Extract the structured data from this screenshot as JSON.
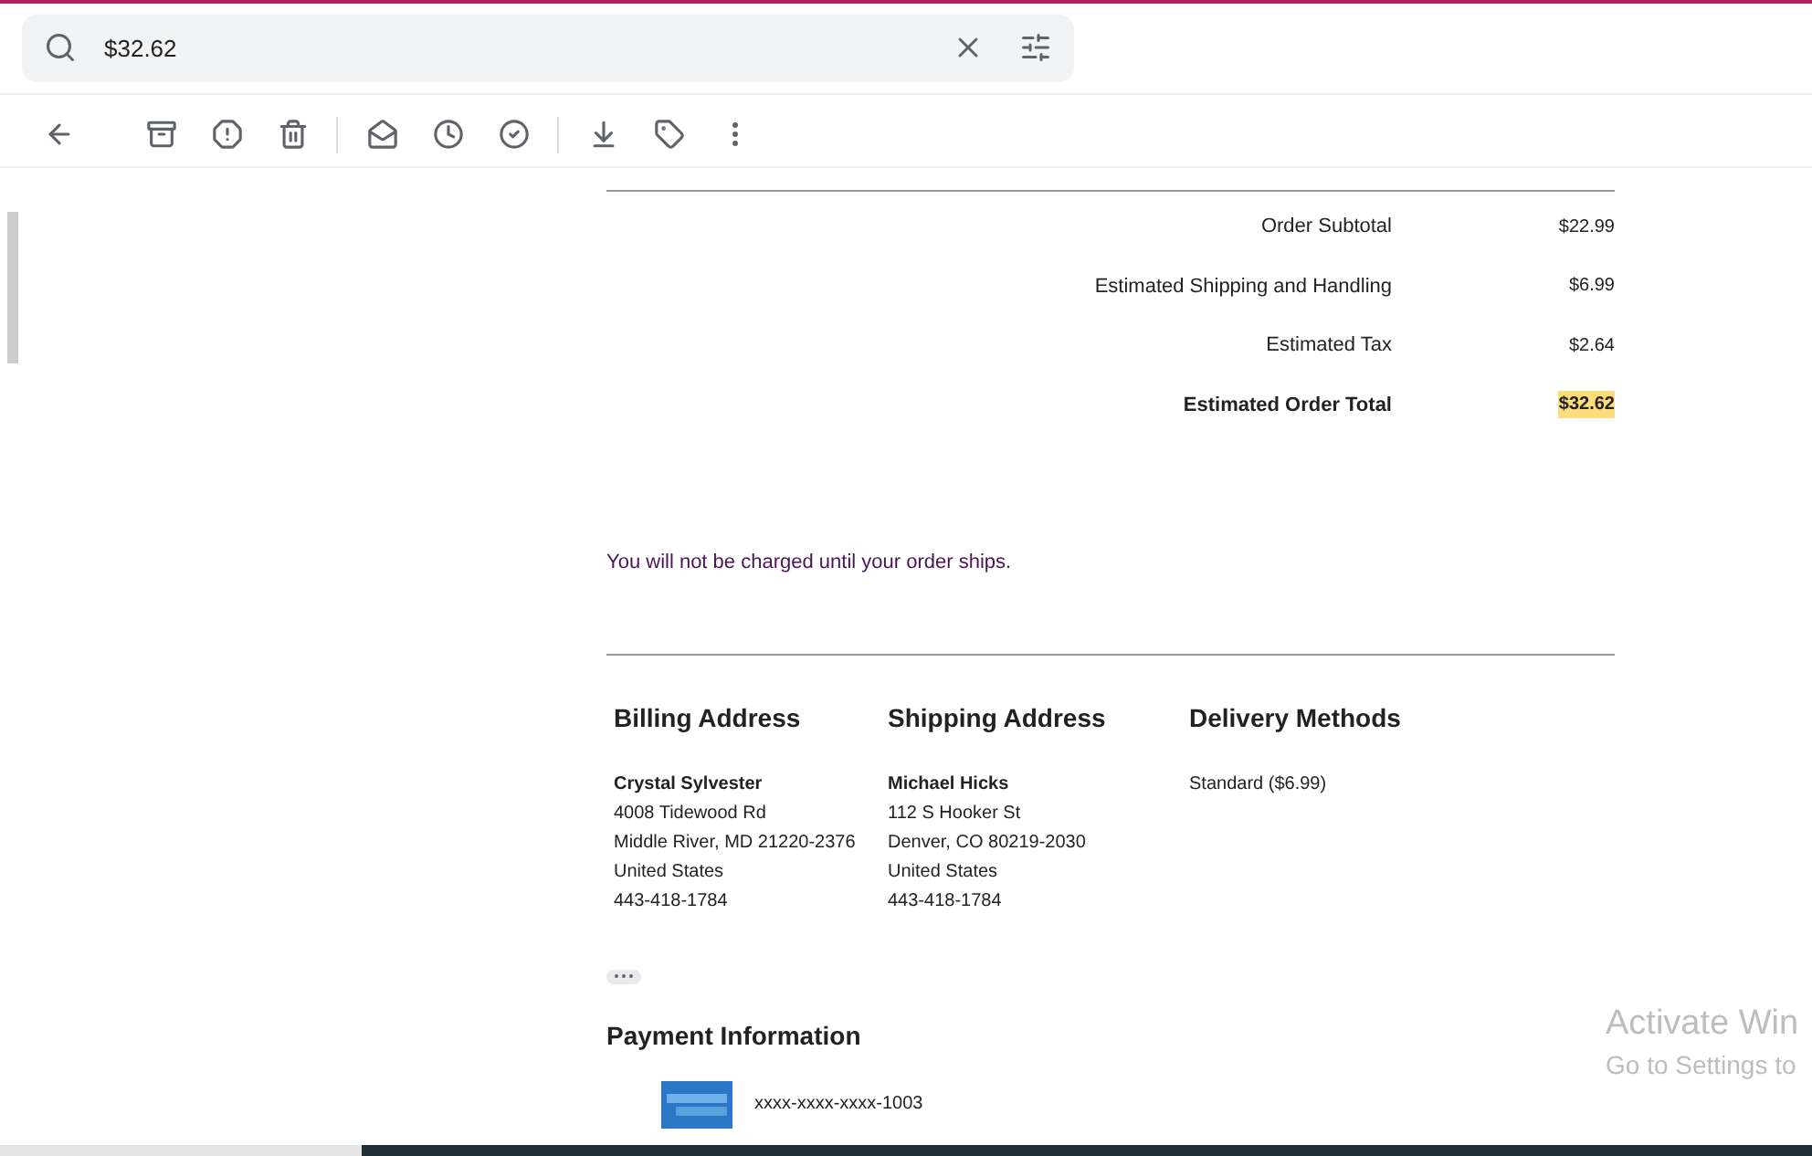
{
  "search": {
    "value": "$32.62"
  },
  "totals": [
    {
      "kind": "line",
      "label": "Order Subtotal",
      "value": "$22.99",
      "highlighted": false
    },
    {
      "kind": "line",
      "label": "Estimated Shipping and Handling",
      "value": "$6.99",
      "highlighted": false
    },
    {
      "kind": "line",
      "label": "Estimated Tax",
      "value": "$2.64",
      "highlighted": false
    },
    {
      "kind": "total",
      "label": "Estimated Order Total",
      "value": "$32.62",
      "highlighted": true
    }
  ],
  "notice": "You will not be charged until your order ships.",
  "addresses": [
    {
      "heading": "Billing Address",
      "name": "Crystal Sylvester",
      "lines": [
        "4008 Tidewood Rd",
        "Middle River, MD 21220-2376",
        "United States",
        "443-418-1784"
      ]
    },
    {
      "heading": "Shipping Address",
      "name": "Michael Hicks",
      "lines": [
        "112 S Hooker St",
        "Denver, CO 80219-2030",
        "United States",
        "443-418-1784"
      ]
    },
    {
      "heading": "Delivery Methods",
      "lines": [
        "Standard ($6.99)"
      ]
    }
  ],
  "payment": {
    "heading": "Payment Information",
    "card_number": "xxxx-xxxx-xxxx-1003"
  },
  "os_notice": {
    "title": "Activate Win",
    "subtitle": "Go to Settings to"
  }
}
